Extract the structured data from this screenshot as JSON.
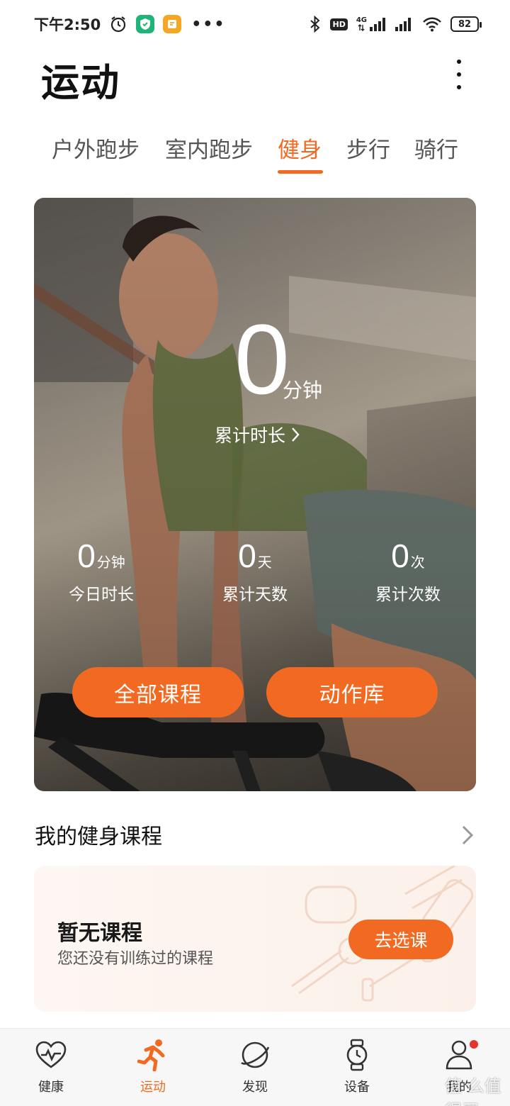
{
  "status_bar": {
    "time": "下午2:50",
    "network_label": "4G",
    "hd_label": "HD",
    "battery": "82",
    "icons": [
      "alarm-icon",
      "security-app-icon",
      "notes-app-icon",
      "more-dots-icon",
      "bluetooth-icon",
      "hd-icon",
      "signal-icon",
      "signal-icon",
      "wifi-icon",
      "battery-icon"
    ]
  },
  "header": {
    "title": "运动",
    "more_icon": "more-vertical-icon"
  },
  "tabs": [
    {
      "label": "户外跑步",
      "active": false
    },
    {
      "label": "室内跑步",
      "active": false
    },
    {
      "label": "健身",
      "active": true
    },
    {
      "label": "步行",
      "active": false
    },
    {
      "label": "骑行",
      "active": false
    }
  ],
  "hero": {
    "total_value": "0",
    "total_unit": "分钟",
    "total_label": "累计时长",
    "stats": [
      {
        "value": "0",
        "unit": "分钟",
        "label": "今日时长"
      },
      {
        "value": "0",
        "unit": "天",
        "label": "累计天数"
      },
      {
        "value": "0",
        "unit": "次",
        "label": "累计次数"
      }
    ],
    "buttons": {
      "all_courses": "全部课程",
      "action_library": "动作库"
    }
  },
  "my_courses": {
    "title": "我的健身课程",
    "empty_title": "暂无课程",
    "empty_subtitle": "您还没有训练过的课程",
    "choose_button": "去选课"
  },
  "bottom_nav": [
    {
      "label": "健康",
      "icon": "heart-pulse-icon",
      "active": false
    },
    {
      "label": "运动",
      "icon": "running-icon",
      "active": true
    },
    {
      "label": "发现",
      "icon": "planet-icon",
      "active": false
    },
    {
      "label": "设备",
      "icon": "watch-icon",
      "active": false
    },
    {
      "label": "我的",
      "icon": "person-icon",
      "active": false,
      "badge": true
    }
  ],
  "colors": {
    "accent": "#f26a21",
    "badge_red": "#e8322c"
  },
  "watermark": "值 么值得买"
}
